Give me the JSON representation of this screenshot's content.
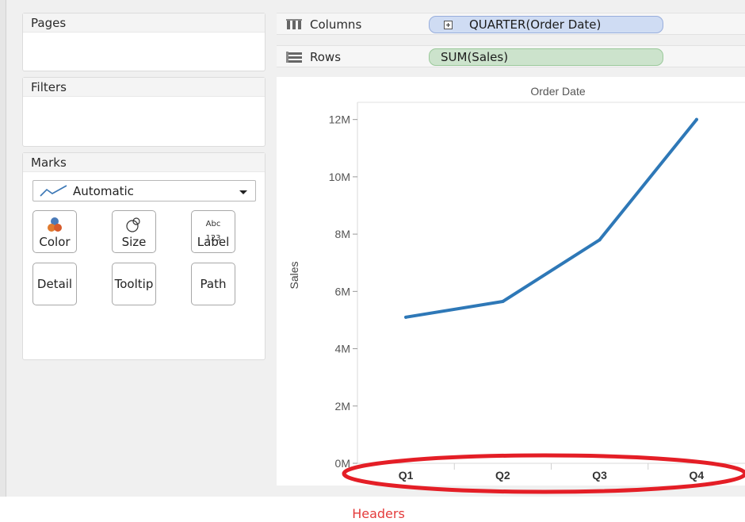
{
  "pages_card": {
    "title": "Pages"
  },
  "filters_card": {
    "title": "Filters"
  },
  "marks_card": {
    "title": "Marks",
    "mark_type": {
      "icon": "line-chart-icon",
      "value": "Automatic"
    },
    "buttons": [
      {
        "label": "Color",
        "icon": "color-icon"
      },
      {
        "label": "Size",
        "icon": "size-icon"
      },
      {
        "label": "Label",
        "icon": "label-icon",
        "icon_text": [
          "Abc",
          "123"
        ]
      },
      {
        "label": "Detail"
      },
      {
        "label": "Tooltip"
      },
      {
        "label": "Path"
      }
    ]
  },
  "shelves": {
    "columns": {
      "label": "Columns",
      "icon": "columns-icon",
      "pill": "QUARTER(Order Date)",
      "pill_color": "#cfdcf3"
    },
    "rows": {
      "label": "Rows",
      "icon": "rows-icon",
      "pill": "SUM(Sales)",
      "pill_color": "#cce3cc"
    }
  },
  "chart_data": {
    "type": "line",
    "title": "Order Date",
    "xlabel": "",
    "ylabel": "Sales",
    "categories": [
      "Q1",
      "Q2",
      "Q3",
      "Q4"
    ],
    "series": [
      {
        "values": [
          5100000,
          5650000,
          7800000,
          12000000
        ],
        "color": "#2e78b7"
      }
    ],
    "yticks": [
      {
        "value": 0,
        "label": "0M"
      },
      {
        "value": 2000000,
        "label": "2M"
      },
      {
        "value": 4000000,
        "label": "4M"
      },
      {
        "value": 6000000,
        "label": "6M"
      },
      {
        "value": 8000000,
        "label": "8M"
      },
      {
        "value": 10000000,
        "label": "10M"
      },
      {
        "value": 12000000,
        "label": "12M"
      }
    ],
    "ylim": [
      0,
      12600000
    ],
    "grid": false
  },
  "annotation": {
    "text": "Headers",
    "color": "#e43b3b"
  }
}
